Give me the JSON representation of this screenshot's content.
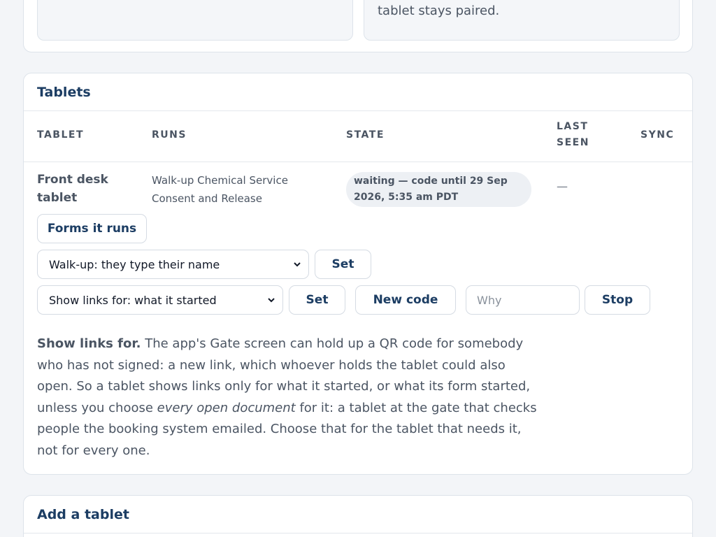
{
  "top_card": {
    "right_text": "tablet stays paired."
  },
  "tablets": {
    "title": "Tablets",
    "columns": [
      "TABLET",
      "RUNS",
      "STATE",
      "LAST SEEN",
      "SYNC"
    ],
    "row": {
      "name": "Front desk tablet",
      "runs": "Walk-up Chemical Service Consent and Release",
      "state": "waiting — code until 29 Sep 2026, 5:35 am PDT",
      "last_seen": "—"
    },
    "forms_button": "Forms it runs",
    "mode_select": "Walk-up: they type their name",
    "mode_set": "Set",
    "links_select": "Show links for: what it started",
    "links_set": "Set",
    "new_code": "New code",
    "why_placeholder": "Why",
    "stop": "Stop",
    "help": {
      "lead": "Show links for.",
      "part1": " The app's Gate screen can hold up a QR code for somebody who has not signed: a new link, which whoever holds the tablet could also open. So a tablet shows links only for what it started, or what its form started, unless you choose ",
      "emph": "every open document",
      "part2": " for it: a tablet at the gate that checks people the booking system emailed. Choose that for the tablet that needs it, not for every one."
    }
  },
  "add_card": {
    "title": "Add a tablet"
  }
}
